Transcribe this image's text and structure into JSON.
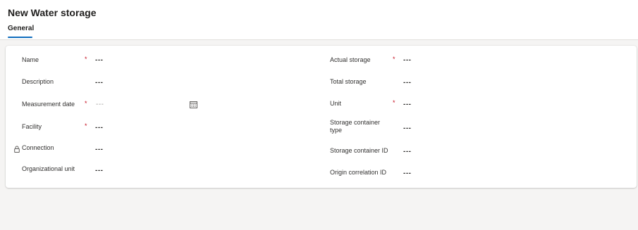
{
  "page": {
    "title": "New Water storage",
    "tab_general": "General"
  },
  "form": {
    "left": [
      {
        "label": "Name",
        "required": "*",
        "value": "---"
      },
      {
        "label": "Description",
        "value": "---"
      },
      {
        "label": "Measurement date",
        "required": "*",
        "placeholder": "---"
      },
      {
        "label": "Facility",
        "required": "*",
        "value": "---"
      },
      {
        "label": "Connection",
        "value": "---"
      },
      {
        "label": "Organizational unit",
        "value": "---"
      }
    ],
    "right": [
      {
        "label": "Actual storage",
        "required": "*",
        "value": "---"
      },
      {
        "label": "Total storage",
        "value": "---"
      },
      {
        "label": "Unit",
        "required": "*",
        "value": "---"
      },
      {
        "label": "Storage container type",
        "value": "---"
      },
      {
        "label": "Storage container ID",
        "value": "---"
      },
      {
        "label": "Origin correlation ID",
        "value": "---"
      }
    ]
  },
  "icons": {
    "calendar": "calendar-icon",
    "lock": "lock-icon"
  },
  "colors": {
    "accent": "#0f6cbd",
    "required": "#c50f1f",
    "background": "#f5f4f3"
  }
}
